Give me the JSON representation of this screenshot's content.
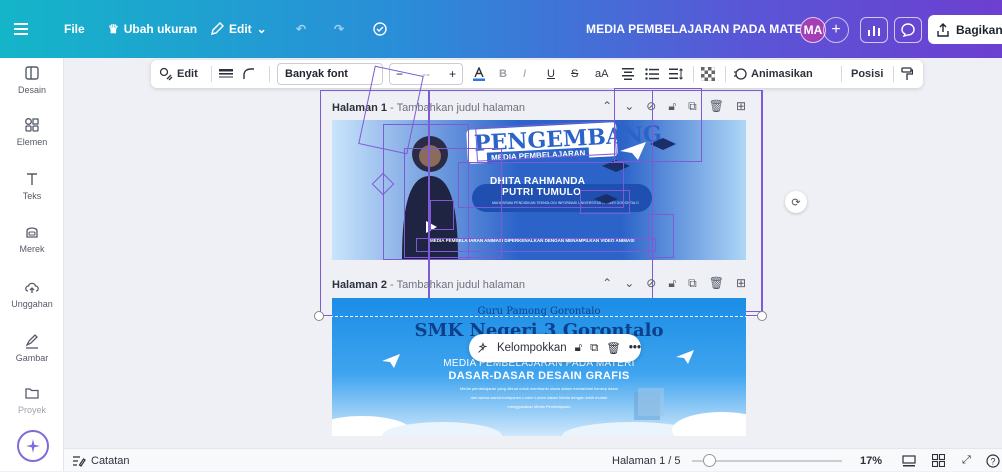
{
  "topbar": {
    "file_label": "File",
    "resize_label": "Ubah ukuran",
    "edit_label": "Edit",
    "doc_title": "MEDIA PEMBELAJARAN PADA MATERI:",
    "avatar_initials": "MA",
    "share_label": "Bagikan"
  },
  "sidebar": {
    "items": [
      {
        "label": "Desain",
        "icon": "layout-icon"
      },
      {
        "label": "Elemen",
        "icon": "shapes-icon"
      },
      {
        "label": "Teks",
        "icon": "text-icon"
      },
      {
        "label": "Merek",
        "icon": "brand-icon"
      },
      {
        "label": "Unggahan",
        "icon": "upload-icon"
      },
      {
        "label": "Gambar",
        "icon": "draw-icon"
      },
      {
        "label": "Proyek",
        "icon": "folder-icon"
      }
    ]
  },
  "context_toolbar": {
    "edit_label": "Edit",
    "font_name": "Banyak font",
    "font_size": "--",
    "case_label": "aA",
    "animate_label": "Animasikan",
    "position_label": "Posisi"
  },
  "pages": [
    {
      "name": "Halaman 1",
      "subtitle": "Tambahkan judul halaman",
      "slide": {
        "title": "PENGEMBANG",
        "subtitle": "MEDIA PEMBELAJARAN",
        "author_line1": "DHITA RAHMANDA",
        "author_line2": "PUTRI TUMULO",
        "author_sub": "MAHASISWA PENDIDIKAN TEKNOLOGI INFORMASI UNIVERSITAS NEGERI GORONTALO",
        "footer": "MEDIA PEMBELAJARAN ANIMASI DIPERKENALKAN DENGAN MENAMPILKAN VIDEO ANIMASI"
      }
    },
    {
      "name": "Halaman 2",
      "subtitle": "Tambahkan judul halaman",
      "slide": {
        "school_top": "Guru Pamong Gorontalo",
        "school": "SMK Negeri 3 Gorontalo",
        "line1": "MEDIA PEMBELAJARAN PADA MATERI",
        "line2": "DASAR-DASAR DESAIN GRAFIS",
        "body1": "Media pembelajaran yang dibuat untuk membantu siswa dalam memahami konsep dasar",
        "body2": "dan warna warna komponen Lorem Lorem dalam Media dengan lebih mudah",
        "body3": "menggunakan Media Pembelajaran"
      }
    }
  ],
  "floating_toolbar": {
    "group_label": "Kelompokkan"
  },
  "bottombar": {
    "notes_label": "Catatan",
    "page_indicator": "Halaman 1 / 5",
    "zoom_label": "17%",
    "zoom_fraction": 0.11
  },
  "colors": {
    "accent": "#7f5ad6",
    "topbar_start": "#14b5c9",
    "topbar_end": "#6c3fd0"
  }
}
